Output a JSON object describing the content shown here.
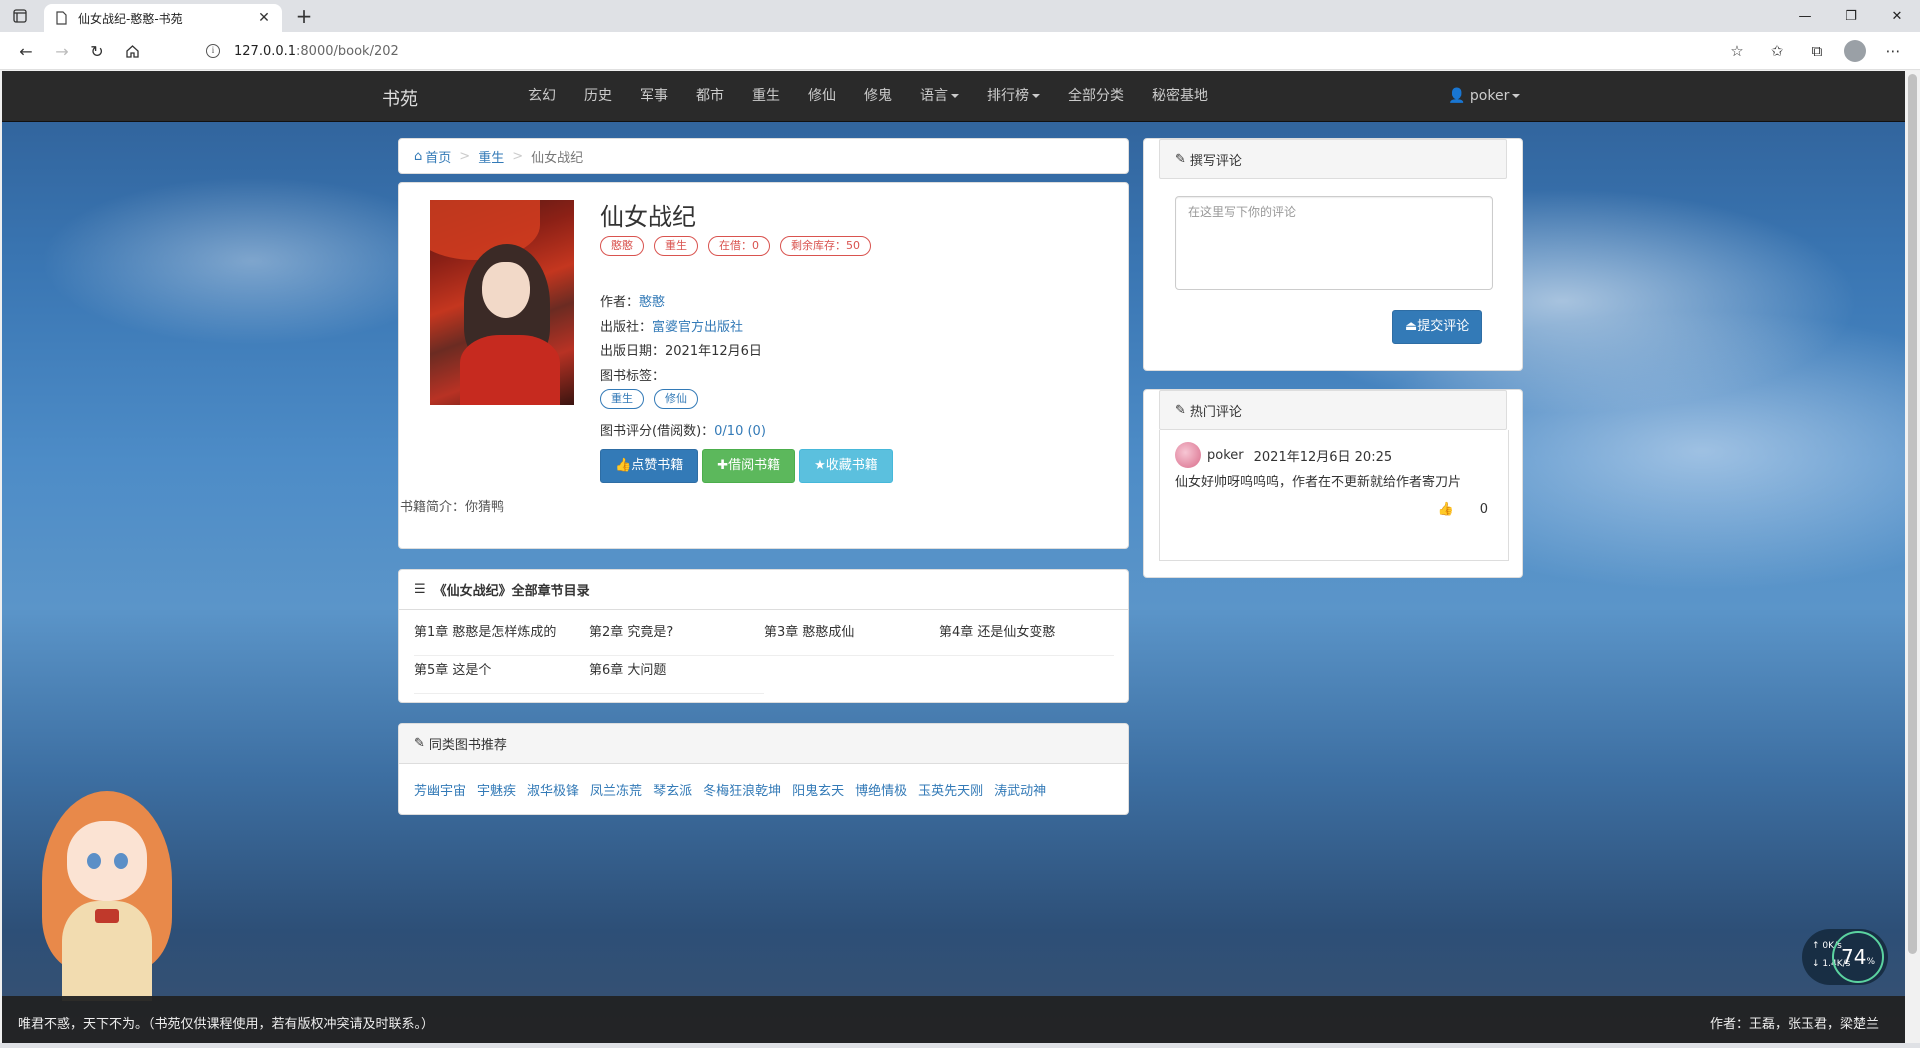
{
  "browser": {
    "tab_title": "仙女战纪-憨憨-书苑",
    "url_host": "127.0.0.1",
    "url_path": ":8000/book/202"
  },
  "navbar": {
    "brand": "书苑",
    "links": [
      "玄幻",
      "历史",
      "军事",
      "都市",
      "重生",
      "修仙",
      "修鬼",
      "语言",
      "排行榜",
      "全部分类",
      "秘密基地"
    ],
    "user": "poker"
  },
  "breadcrumb": {
    "home": "首页",
    "category": "重生",
    "current": "仙女战纪"
  },
  "book": {
    "title": "仙女战纪",
    "badges": [
      "憨憨",
      "重生",
      "在借：0",
      "剩余库存：50"
    ],
    "author_label": "作者：",
    "author": "憨憨",
    "publisher_label": "出版社：",
    "publisher": "富婆官方出版社",
    "pubdate_label": "出版日期：",
    "pubdate": "2021年12月6日",
    "tags_label": "图书标签：",
    "tags": [
      "重生",
      "修仙"
    ],
    "score_label": "图书评分(借阅数)：",
    "score": "0/10 (0)",
    "btn_like": "点赞书籍",
    "btn_borrow": "借阅书籍",
    "btn_collect": "收藏书籍",
    "intro": "书籍简介：你猜鸭"
  },
  "chapters": {
    "heading": "《仙女战纪》全部章节目录",
    "items": [
      "第1章 憨憨是怎样炼成的",
      "第2章 究竟是?",
      "第3章 憨憨成仙",
      "第4章 还是仙女变憨",
      "第5章 这是个",
      "第6章 大问题"
    ]
  },
  "recommend": {
    "heading": "同类图书推荐",
    "items": [
      "芳幽宇宙",
      "宇魅疾",
      "淑华极锋",
      "凤兰冻荒",
      "琴玄派",
      "冬梅狂浪乾坤",
      "阳鬼玄天",
      "博绝情极",
      "玉英先天刚",
      "涛武动神"
    ]
  },
  "comment": {
    "heading": "撰写评论",
    "placeholder": "在这里写下你的评论",
    "submit": "提交评论"
  },
  "hot": {
    "heading": "热门评论",
    "user": "poker",
    "time": "2021年12月6日 20:25",
    "text": "仙女好帅呀呜呜呜，作者在不更新就给作者寄刀片",
    "likes": "0"
  },
  "footer": {
    "left": "唯君不惑，天下不为。（书苑仅供课程使用，若有版权冲突请及时联系。）",
    "right": "作者：王磊，张玉君，梁楚兰"
  },
  "speed": {
    "up": "0K/s",
    "down": "1.4K/s",
    "percent": "74"
  }
}
